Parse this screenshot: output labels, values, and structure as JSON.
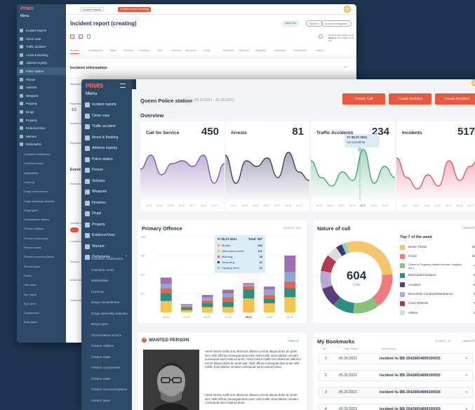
{
  "back": {
    "menu_label": "Menu",
    "logo": "PRMIS",
    "tabs": [
      "Incident reports",
      "Incident report (creating)"
    ],
    "page_title": "Incident report (creating)",
    "user_chip": "Jane Doe",
    "badge_medium": "Medium",
    "badge_status": "Under investigation",
    "created_label": "Created: 05.04.2021 11:18 AM",
    "updated_label": "Updated: 05.04.2021 11:18 AM",
    "subtabs": [
      "Incident",
      "Investigation",
      "Tasks",
      "Persons",
      "Property",
      "Vault",
      "Vehicles",
      "Weapons",
      "Drugs",
      "Evidence",
      "Offences",
      "Mapping",
      "Narrative",
      "Documents",
      "History"
    ],
    "section_title": "Incident information",
    "section_2": "Event det",
    "field_labels": [
      "Reported",
      "Reported at",
      "Incident date",
      "Reported by",
      "Summary",
      "Juvenile inv.",
      "Location of",
      "Session",
      "Actual addr",
      "Actual addr"
    ],
    "field_value_time": "10",
    "dropdown_value": "Statement",
    "sidebar": [
      "Incident reports",
      "Crime case",
      "Traffic accident",
      "Arrest & Booking",
      "Address registry",
      "Police station",
      "Person",
      "Vehicles",
      "Weapons",
      "Property",
      "Drugs",
      "Property",
      "Evidence/View",
      "Warrant",
      "Dictionaries"
    ],
    "sidebar_sub": [
      "Countries subdivisions",
      "Countries courts",
      "Nationalities",
      "Currency",
      "Drugs consumtment",
      "Drugs ownership statuses",
      "Drugs types",
      "Circumstance actions",
      "Firearm callibers",
      "Firearm components",
      "Firearm makes",
      "Firearm recovered places",
      "Firearm types",
      "Races",
      "Hair colors",
      "Eye colors",
      "Eye colors",
      "Complexions",
      "Body types"
    ]
  },
  "front": {
    "logo": "PRMIS",
    "menu_label": "Menu",
    "sidebar": [
      "Incident reports",
      "Crime case",
      "Traffic accident",
      "Arrest & Booking",
      "Address registry",
      "Police station",
      "Person",
      "Vehicles",
      "Weapons",
      "Firearms",
      "Drugs",
      "Property",
      "Evidence/View",
      "Warrant",
      "Dictionaries"
    ],
    "sidebar_sub": [
      "Countries subdivisions",
      "Countries courts",
      "Nationalities",
      "Currency",
      "Drugs consumtment",
      "Drugs ownership statuses",
      "Drugs types",
      "Circumstance actions",
      "Firearm calibers",
      "Firearm make",
      "Firearm components",
      "Firearm make",
      "Firearm recovered places",
      "Firearm types",
      "Races",
      "Hair colors"
    ],
    "station_title": "Queen Police station",
    "date_range": "(05.23.2021 - 05.29.2021)",
    "buttons": [
      "Create Call",
      "Create Incident",
      "Create Accident"
    ],
    "overview_title": "Overview",
    "stats": [
      {
        "label": "Call for Service",
        "value": "450",
        "color": "#7c5aa6"
      },
      {
        "label": "Arrests",
        "value": "81",
        "color": "#3c3f63"
      },
      {
        "label": "Traffic Accidents",
        "value": "234",
        "color": "#3fa978"
      },
      {
        "label": "Incidents",
        "value": "517",
        "color": "#e0566a"
      }
    ],
    "stat_ticks": [
      "05.23",
      "05.24",
      "05.25",
      "05.26",
      "05.27",
      "05.28",
      "05.29"
    ],
    "tooltip_accident": {
      "date": "Fr 05.27.2021",
      "text": "54 accidents"
    },
    "primary_title": "Primary Offence",
    "primary_quantity": "Quantity: 994",
    "primary_tooltip": {
      "date": "Fr 05.27.2021",
      "total": "Total: 397",
      "rows": [
        {
          "name": "Murder",
          "value": "184",
          "color": "#f0a48c"
        },
        {
          "name": "Attempted murder",
          "value": "121",
          "color": "#f3c74f"
        },
        {
          "name": "Maiming",
          "value": "38",
          "color": "#e85d8a"
        },
        {
          "name": "Wounding",
          "value": "32",
          "color": "#2f3e6a"
        },
        {
          "name": "Causing harm",
          "value": "12",
          "color": "#8fd0cb"
        }
      ]
    },
    "nature_title": "Nature of call",
    "view_all": "View All",
    "donut_value": "604",
    "donut_label": "Calls",
    "top7_title": "Top-7 of the week",
    "top7": [
      {
        "name": "Bomb Threat",
        "count": "180",
        "color": "#f6c46a"
      },
      {
        "name": "Crime",
        "count": "100",
        "color": "#f07a7d"
      },
      {
        "name": "Crime in Progress (active shooter, burglary, etc.)",
        "count": "76",
        "color": "#8cc07f"
      },
      {
        "name": "Barricaded Suspect",
        "count": "61",
        "color": "#2e8e81"
      },
      {
        "name": "Accident",
        "count": "56",
        "color": "#5a3d7c"
      },
      {
        "name": "Disorderly Conduct/Disturbance",
        "count": "51",
        "color": "#b9a9d6"
      },
      {
        "name": "Court Witness",
        "count": "48",
        "color": "#b23a4c"
      },
      {
        "name": "Others",
        "count": "32",
        "color": "#d9dde3"
      }
    ],
    "wanted_title": "WANTED PERSON",
    "wanted_text": "Amet minim mollit non deserunt ullamco est sit aliqua dolor do amet sint. Velit officia consequat duis enim velit mollit. Exercitation veniam consequat sunt nostrud amet. Amet minim mollit non deserunt ullamco est sit aliqua dolor do amet sint. Velit officia consequat duis enim velit mollit. Exercitation veniam consequat sunt nostrud amet.",
    "wanted_text2": "Amet minim mollit non deserunt ullamco est sit aliqua dolor do amet sint. Velit officia consequat duis enim velit mollit. Exercitation veniam consequat sunt nostrud amet.",
    "bookmarks_title": "My Bookmarks",
    "bookmarks_quantity": "Quantity: 15",
    "bookmarks_headers": [
      "№",
      "Date added",
      "Bookmarks"
    ],
    "bookmarks": [
      {
        "n": "1",
        "date": "05.26.2021",
        "text": "Incident № BB-35428654899100025"
      },
      {
        "n": "2",
        "date": "05.26.2021",
        "text": "Incident № BB-35428654899100025"
      },
      {
        "n": "3",
        "date": "05.25.2021",
        "text": "Incident № BB-35428654899100025"
      },
      {
        "n": "4",
        "date": "05.20.2021",
        "text": "Incident № BB-35428654899100025"
      }
    ]
  },
  "chart_data": {
    "type": "bar",
    "title": "Primary Offence",
    "categories": [
      "05.23",
      "05.24",
      "05.25",
      "05.26",
      "05.27",
      "05.28",
      "05.29"
    ],
    "ylim": [
      0,
      1000
    ],
    "yticks": [
      "1000",
      "750",
      "500",
      "250"
    ],
    "series": [
      {
        "name": "Murder",
        "values": [
          150,
          30,
          70,
          70,
          184,
          120,
          200
        ]
      },
      {
        "name": "Attempted murder",
        "values": [
          100,
          30,
          50,
          70,
          121,
          60,
          120
        ]
      },
      {
        "name": "Maiming",
        "values": [
          70,
          20,
          40,
          60,
          38,
          50,
          90
        ]
      },
      {
        "name": "Wounding",
        "values": [
          60,
          20,
          40,
          50,
          32,
          70,
          120
        ]
      },
      {
        "name": "Causing harm",
        "values": [
          80,
          10,
          30,
          50,
          12,
          40,
          220
        ]
      }
    ],
    "colors": [
      "#f3c74f",
      "#2e8e81",
      "#e2674f",
      "#8fa7d6",
      "#9f6fb3"
    ]
  }
}
